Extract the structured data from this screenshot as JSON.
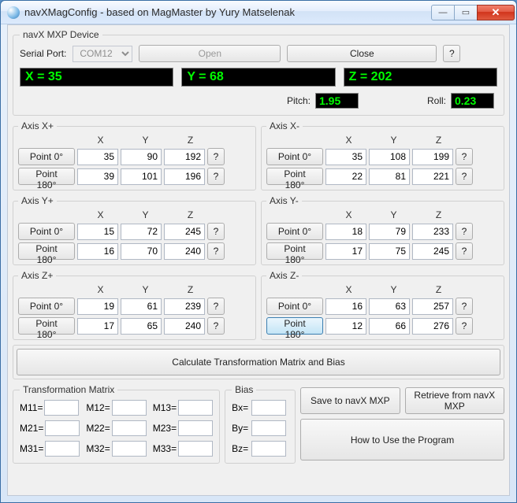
{
  "window": {
    "title": "navXMagConfig - based on MagMaster by Yury Matselenak"
  },
  "device": {
    "legend": "navX MXP Device",
    "serial_label": "Serial Port:",
    "serial_value": "COM12",
    "open_label": "Open",
    "close_label": "Close",
    "help_label": "?",
    "xyz": {
      "x": "X = 35",
      "y": "Y = 68",
      "z": "Z = 202"
    },
    "pitch_label": "Pitch:",
    "pitch_value": "1.95",
    "roll_label": "Roll:",
    "roll_value": "0.23"
  },
  "axes": [
    {
      "legend": "Axis X+",
      "p0": {
        "x": "35",
        "y": "90",
        "z": "192"
      },
      "p180": {
        "x": "39",
        "y": "101",
        "z": "196"
      }
    },
    {
      "legend": "Axis X-",
      "p0": {
        "x": "35",
        "y": "108",
        "z": "199"
      },
      "p180": {
        "x": "22",
        "y": "81",
        "z": "221"
      }
    },
    {
      "legend": "Axis Y+",
      "p0": {
        "x": "15",
        "y": "72",
        "z": "245"
      },
      "p180": {
        "x": "16",
        "y": "70",
        "z": "240"
      }
    },
    {
      "legend": "Axis Y-",
      "p0": {
        "x": "18",
        "y": "79",
        "z": "233"
      },
      "p180": {
        "x": "17",
        "y": "75",
        "z": "245"
      }
    },
    {
      "legend": "Axis Z+",
      "p0": {
        "x": "19",
        "y": "61",
        "z": "239"
      },
      "p180": {
        "x": "17",
        "y": "65",
        "z": "240"
      }
    },
    {
      "legend": "Axis Z-",
      "p0": {
        "x": "16",
        "y": "63",
        "z": "257"
      },
      "p180": {
        "x": "12",
        "y": "66",
        "z": "276"
      }
    }
  ],
  "axis_labels": {
    "col_x": "X",
    "col_y": "Y",
    "col_z": "Z",
    "point0": "Point 0°",
    "point180": "Point 180°",
    "q": "?"
  },
  "calc_label": "Calculate Transformation Matrix and Bias",
  "matrix": {
    "legend": "Transformation Matrix",
    "m11_l": "M11=",
    "m12_l": "M12=",
    "m13_l": "M13=",
    "m21_l": "M21=",
    "m22_l": "M22=",
    "m23_l": "M23=",
    "m31_l": "M31=",
    "m32_l": "M32=",
    "m33_l": "M33=",
    "m11": "",
    "m12": "",
    "m13": "",
    "m21": "",
    "m22": "",
    "m23": "",
    "m31": "",
    "m32": "",
    "m33": ""
  },
  "bias": {
    "legend": "Bias",
    "bx_l": "Bx=",
    "by_l": "By=",
    "bz_l": "Bz=",
    "bx": "",
    "by": "",
    "bz": ""
  },
  "actions": {
    "save": "Save to\nnavX MXP",
    "retrieve": "Retrieve from\nnavX MXP",
    "howto": "How to Use the Program"
  }
}
